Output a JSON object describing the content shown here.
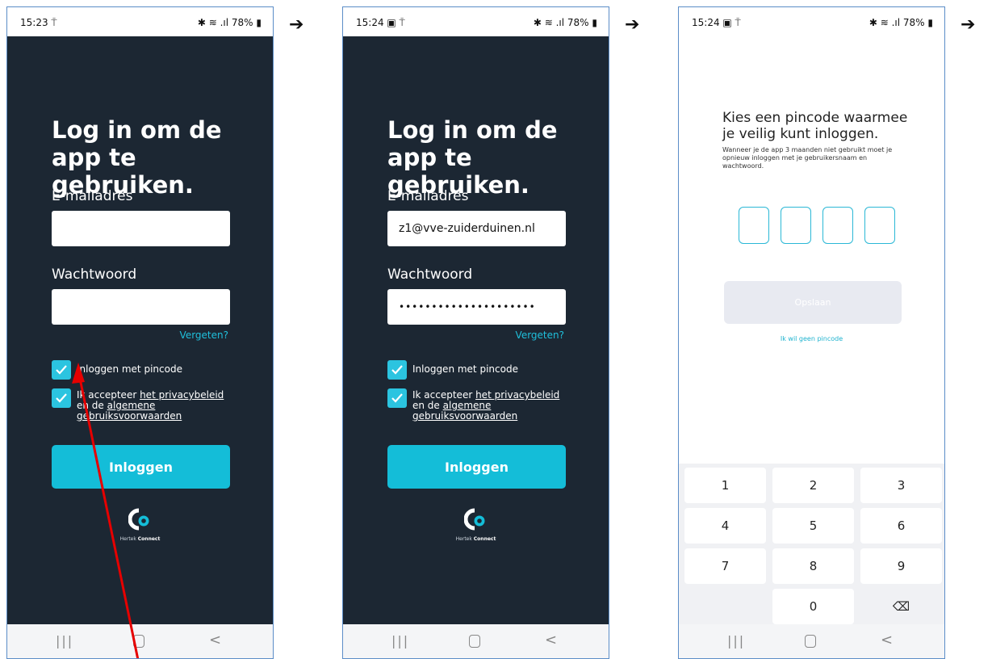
{
  "arrows": {
    "symbol": "➔"
  },
  "phone1": {
    "status": {
      "time": "15:23 ⍑",
      "right": "✱ ≋ .ıl 78% ▮"
    },
    "title": "Log in om de app te gebruiken.",
    "email_label": "E-mailadres",
    "email_value": "",
    "password_label": "Wachtwoord",
    "password_value": "",
    "forgot": "Vergeten?",
    "checkbox_pin": "Inloggen met pincode",
    "checkbox_terms_a": "Ik accepteer ",
    "checkbox_terms_link1": "het privacybeleid",
    "checkbox_terms_b": " en de ",
    "checkbox_terms_link2": "algemene gebruiksvoorwaarden",
    "login_button": "Inloggen",
    "logo_text_a": "Hertek ",
    "logo_text_b": "Connect"
  },
  "phone2": {
    "status": {
      "time": "15:24 ▣ ⍑",
      "right": "✱ ≋ .ıl 78% ▮"
    },
    "title": "Log in om de app te gebruiken.",
    "email_label": "E-mailadres",
    "email_value": "z1@vve-zuiderduinen.nl",
    "password_label": "Wachtwoord",
    "password_value": "•••••••••••••••••••••",
    "forgot": "Vergeten?",
    "checkbox_pin": "Inloggen met pincode",
    "checkbox_terms_a": "Ik accepteer ",
    "checkbox_terms_link1": "het privacybeleid",
    "checkbox_terms_b": " en de ",
    "checkbox_terms_link2": "algemene gebruiksvoorwaarden",
    "login_button": "Inloggen",
    "logo_text_a": "Hertek ",
    "logo_text_b": "Connect"
  },
  "phone3": {
    "status": {
      "time": "15:24 ▣ ⍑",
      "right": "✱ ≋ .ıl 78% ▮"
    },
    "title": "Kies een pincode waarmee je veilig kunt inloggen.",
    "subtitle": "Wanneer je de app 3 maanden niet gebruikt moet je opnieuw inloggen met je gebruikersnaam en wachtwoord.",
    "save_button": "Opslaan",
    "no_pin": "Ik wil geen pincode",
    "keys": [
      "1",
      "2",
      "3",
      "4",
      "5",
      "6",
      "7",
      "8",
      "9",
      "0",
      "⌫"
    ]
  },
  "nav": {
    "recent": "|||",
    "back": "<"
  },
  "colors": {
    "background_dark": "#1c2733",
    "accent": "#14bdd8",
    "annotation_arrow": "#e60000"
  }
}
